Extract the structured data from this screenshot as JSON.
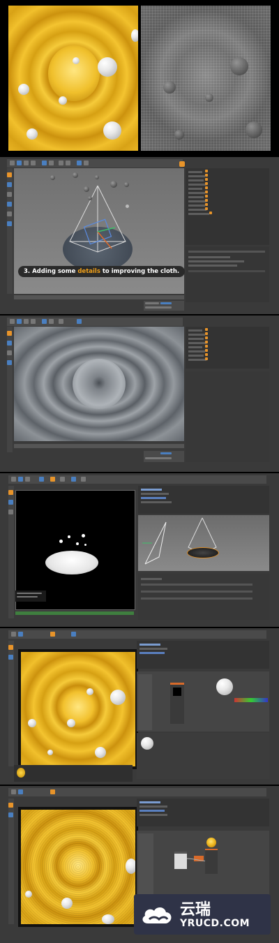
{
  "tutorial": {
    "step_caption_prefix": "3. Adding some ",
    "step_caption_highlight": "details",
    "step_caption_suffix": " to improving the cloth."
  },
  "watermark": {
    "logo_text": "云瑞",
    "site_text": "YRUCD.COM"
  },
  "colors": {
    "accent_orange": "#f0a01a",
    "gold": "#f4c430",
    "c4d_panel": "#3a3a3a",
    "c4d_viewport": "#6a6a6a",
    "watermark_bg": "#2f3347"
  },
  "icons": [
    "cloud-logo-icon",
    "light-icon",
    "camera-icon",
    "sphere-icon",
    "material-icon"
  ]
}
